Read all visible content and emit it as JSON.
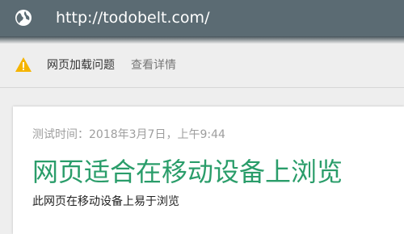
{
  "header": {
    "url": "http://todobelt.com/",
    "icon": "globe-icon",
    "background_color": "#5b6b73"
  },
  "warning": {
    "icon": "warning-triangle-icon",
    "icon_color": "#f5b400",
    "message": "网页加载问题",
    "link_label": "查看详情"
  },
  "result": {
    "test_time": "测试时间：2018年3月7日，上午9:44",
    "title": "网页适合在移动设备上浏览",
    "description": "此网页在移动设备上易于浏览",
    "title_color": "#2a9d6a"
  }
}
